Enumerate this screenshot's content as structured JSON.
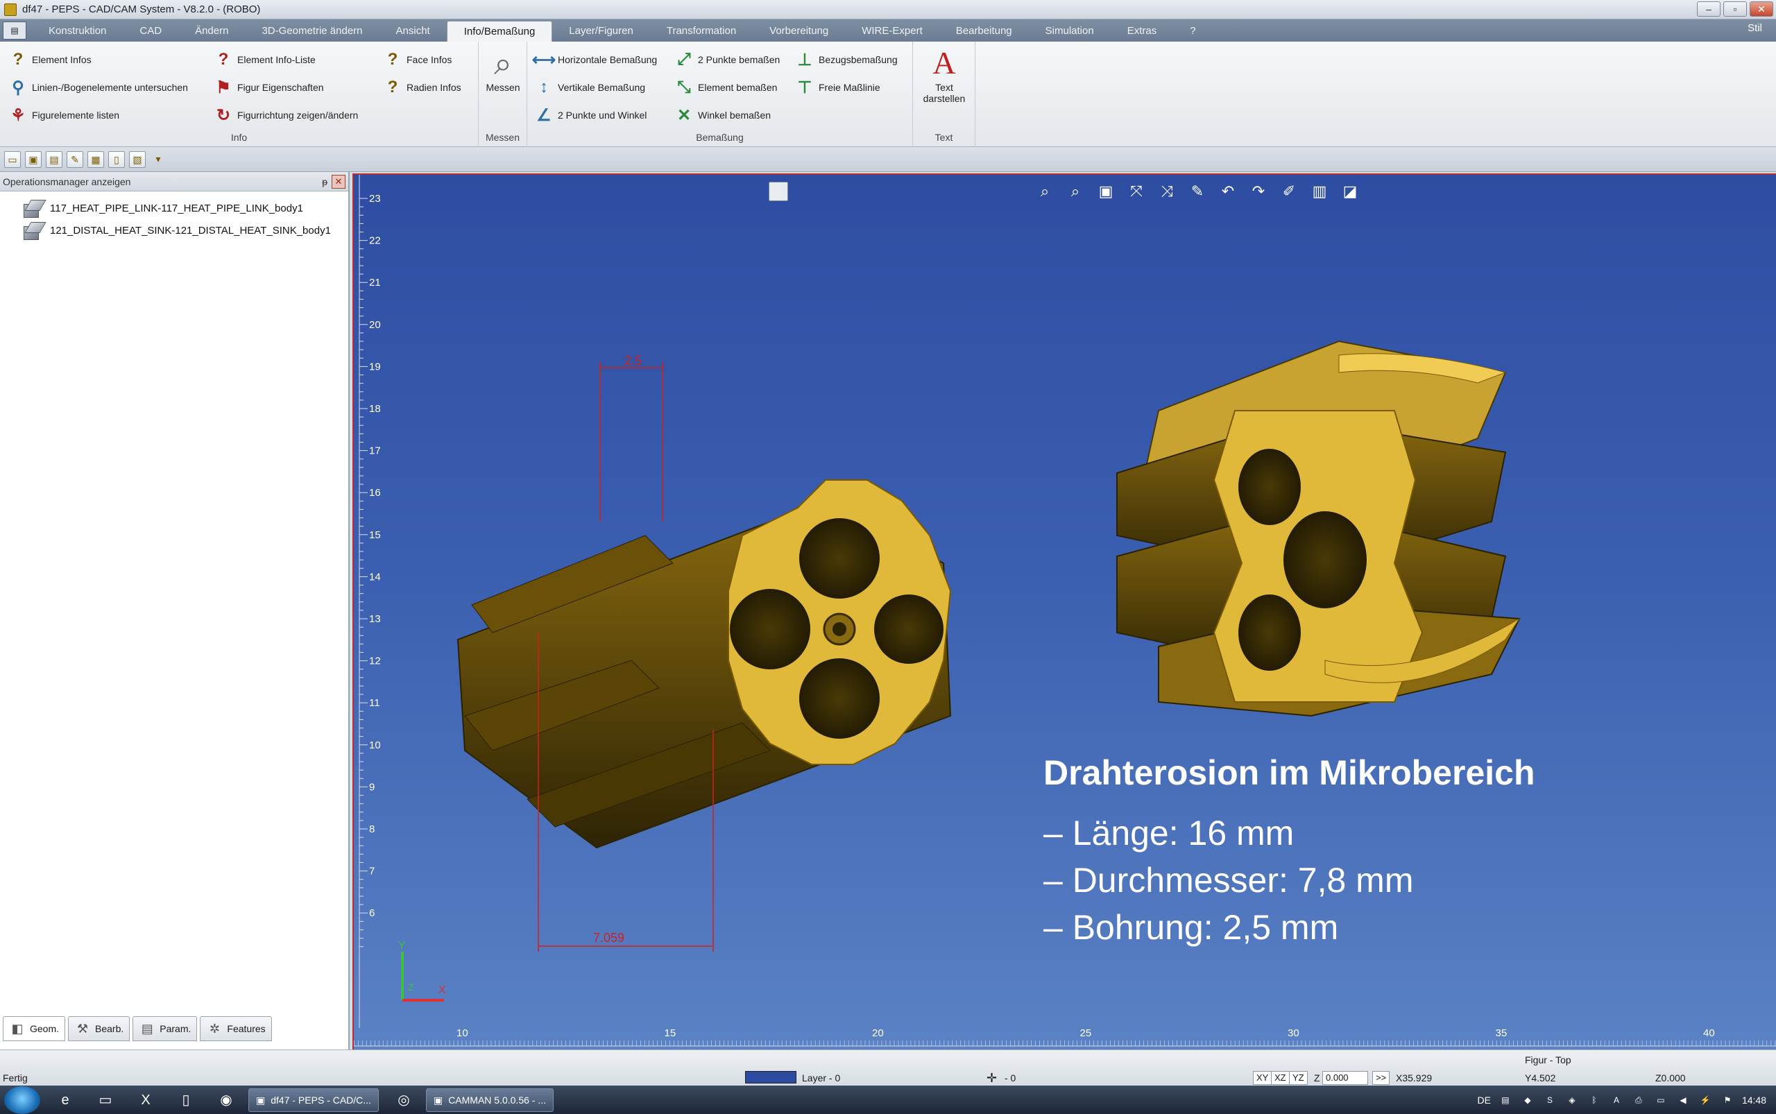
{
  "window": {
    "title": "df47 - PEPS - CAD/CAM System -  V8.2.0 - (ROBO)",
    "buttons": [
      "–",
      "▫",
      "✕"
    ]
  },
  "menu": {
    "app_button": "▤",
    "tabs": [
      "Konstruktion",
      "CAD",
      "Ändern",
      "3D-Geometrie ändern",
      "Ansicht",
      "Info/Bemaßung",
      "Layer/Figuren",
      "Transformation",
      "Vorbereitung",
      "WIRE-Expert",
      "Bearbeitung",
      "Simulation",
      "Extras",
      "?"
    ],
    "active_tab": "Info/Bemaßung",
    "style_label": "Stil"
  },
  "ribbon": {
    "info": {
      "label": "Info",
      "col1": [
        "Element Infos",
        "Linien-/Bogenelemente untersuchen",
        "Figurelemente listen"
      ],
      "col2": [
        "Element Info-Liste",
        "Figur Eigenschaften",
        "Figurrichtung zeigen/ändern"
      ],
      "col3": [
        "Face Infos",
        "Radien Infos"
      ]
    },
    "messen": {
      "label": "Messen",
      "button": "Messen"
    },
    "bemassung": {
      "label": "Bemaßung",
      "col1": [
        "Horizontale Bemaßung",
        "Vertikale Bemaßung",
        "2 Punkte und Winkel"
      ],
      "col2": [
        "2 Punkte bemaßen",
        "Element bemaßen",
        "Winkel bemaßen"
      ],
      "col3": [
        "Bezugsbemaßung",
        "Freie Maßlinie"
      ]
    },
    "text": {
      "label": "Text",
      "button_line1": "Text",
      "button_line2": "darstellen"
    }
  },
  "left_panel": {
    "header": "Operationsmanager anzeigen",
    "pin": "ᵽ",
    "close": "✕",
    "tree_items": [
      "117_HEAT_PIPE_LINK-117_HEAT_PIPE_LINK_body1",
      "121_DISTAL_HEAT_SINK-121_DISTAL_HEAT_SINK_body1"
    ],
    "tabs": [
      "Geom.",
      "Bearb.",
      "Param.",
      "Features"
    ]
  },
  "viewport": {
    "background_top": "#2e4da2",
    "background_bottom": "#5a82c4",
    "ruler_left_labels": [
      "23",
      "22",
      "21",
      "20",
      "19",
      "18",
      "17",
      "16",
      "15",
      "14",
      "13",
      "12",
      "11",
      "10",
      "9",
      "8",
      "7",
      "6"
    ],
    "ruler_bottom_labels": [
      "10",
      "15",
      "20",
      "25",
      "30",
      "35",
      "40"
    ],
    "dimension_top": "2.5",
    "dimension_bottom": "7.059",
    "axis_y": "Y",
    "axis_x": "X",
    "axis_z": "Z",
    "part_color": "#e0b93a",
    "caption": {
      "title": "Drahterosion im Mikrobereich",
      "lines": [
        "– Länge: 16 mm",
        "– Durchmesser: 7,8 mm",
        "– Bohrung: 2,5 mm"
      ]
    }
  },
  "status": {
    "left": "Fertig",
    "layer": "Layer - 0",
    "layer_value": "- 0",
    "figur": "Figur  - Top",
    "planes": [
      "XY",
      "XZ",
      "YZ"
    ],
    "z_label": "Z",
    "z_value": "0.000",
    "arrow": ">>",
    "x_coord": "X35.929",
    "y_coord": "Y4.502",
    "z_coord": "Z0.000"
  },
  "taskbar": {
    "tasks": [
      "df47 - PEPS - CAD/C...",
      "CAMMAN 5.0.0.56 - ..."
    ],
    "lang": "DE",
    "time": "14:48"
  }
}
